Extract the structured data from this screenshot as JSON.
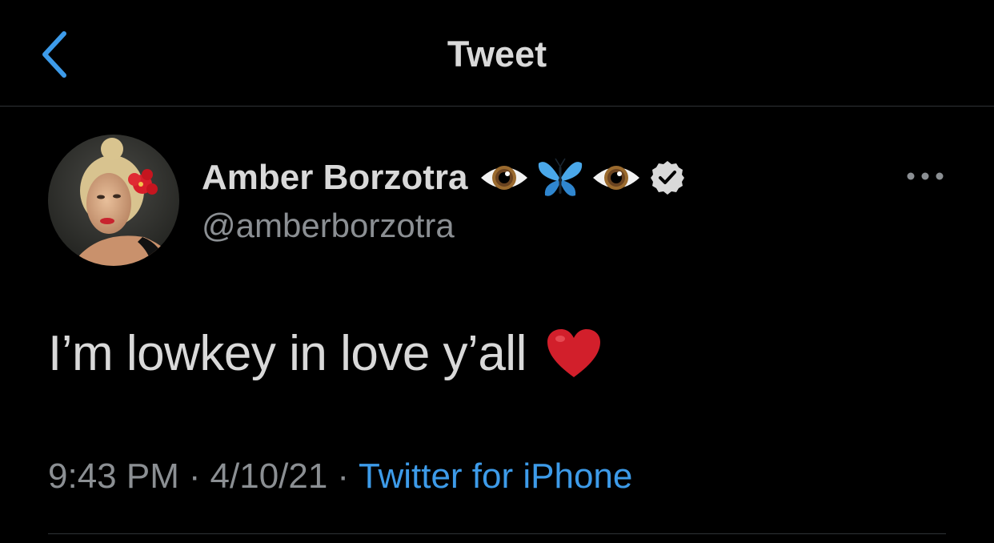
{
  "header": {
    "title": "Tweet",
    "back_icon": "chevron-left-icon"
  },
  "colors": {
    "background": "#000000",
    "accent": "#3d9be9",
    "primary_text": "#d9d9d9",
    "secondary_text": "#8b8f93",
    "divider": "#2f3336",
    "heart": "#d21f2b"
  },
  "author": {
    "display_name": "Amber Borzotra",
    "name_emojis": [
      "eye-emoji",
      "butterfly-emoji",
      "eye-emoji"
    ],
    "verified": true,
    "handle": "@amberborzotra",
    "avatar": "profile-photo"
  },
  "tweet": {
    "text": "I’m lowkey in love y’all",
    "trailing_emoji": "red-heart-emoji",
    "time": "9:43 PM",
    "separator": "·",
    "date": "4/10/21",
    "source": "Twitter for iPhone"
  }
}
